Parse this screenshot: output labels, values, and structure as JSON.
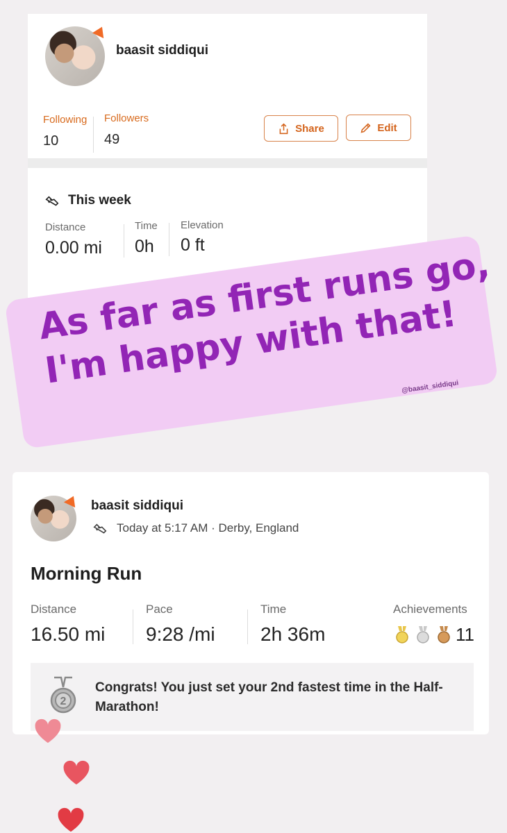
{
  "profile": {
    "username": "baasit siddiqui",
    "following_label": "Following",
    "following_value": "10",
    "followers_label": "Followers",
    "followers_value": "49",
    "share_label": "Share",
    "edit_label": "Edit"
  },
  "this_week": {
    "title": "This week",
    "distance_label": "Distance",
    "distance_value": "0.00 mi",
    "time_label": "Time",
    "time_value": "0h",
    "elevation_label": "Elevation",
    "elevation_value": "0 ft"
  },
  "sticker": {
    "line1": "As far as first runs go,",
    "line2": "I'm happy with that!",
    "handle": "@baasit_siddiqui"
  },
  "activity": {
    "username": "baasit siddiqui",
    "meta": "Today at 5:17 AM · Derby, England",
    "title": "Morning Run",
    "distance_label": "Distance",
    "distance_value": "16.50 mi",
    "pace_label": "Pace",
    "pace_value": "9:28 /mi",
    "time_label": "Time",
    "time_value": "2h 36m",
    "achievements_label": "Achievements",
    "achievements_count": "11",
    "congrats": "Congrats! You just set your 2nd fastest time in the Half-Marathon!"
  },
  "colors": {
    "accent": "#d86a1d",
    "sticker_bg": "#f2ccf4",
    "sticker_text": "#9225b5",
    "heart": "#e8454f"
  },
  "icons": [
    "share-icon",
    "edit-pencil-icon",
    "running-shoe-icon",
    "gold-medal-icon",
    "silver-medal-icon",
    "bronze-medal-icon",
    "second-place-medal-icon",
    "heart-icon"
  ]
}
